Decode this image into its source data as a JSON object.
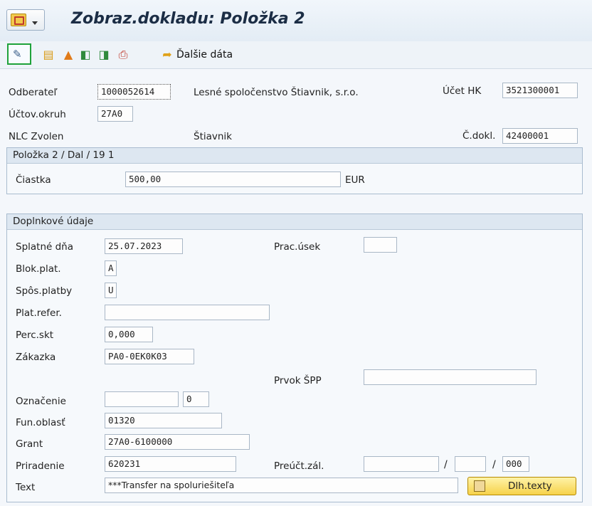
{
  "window": {
    "title": "Zobraz.dokladu: Položka 2"
  },
  "toolbar": {
    "icons": [
      "display-change-icon",
      "header-icon",
      "overview-icon",
      "previous-icon",
      "next-icon",
      "print-icon",
      "additional-data-icon"
    ],
    "more_label": "Ďalšie dáta"
  },
  "header": {
    "customer_label": "Odberateľ",
    "customer_value": "1000052614",
    "customer_name": "Lesné spoločenstvo Štiavnik, s.r.o.",
    "gl_label": "Účet HK",
    "gl_value": "3521300001",
    "company_code_label": "Účtov.okruh",
    "company_code_value": "27A0",
    "city_left": "NLC Zvolen",
    "city_right": "Štiavnik",
    "doc_label": "Č.dokl.",
    "doc_value": "42400001"
  },
  "item_group": {
    "title": "Položka 2 / Dal / 19 1",
    "amount_label": "Čiastka",
    "amount_value": "500,00",
    "currency": "EUR"
  },
  "additional": {
    "title": "Doplnkové údaje",
    "due_label": "Splatné dňa",
    "due_value": "25.07.2023",
    "bus_area_label": "Prac.úsek",
    "bus_area_value": "",
    "pay_block_label": "Blok.plat.",
    "pay_block_value": "A",
    "pay_method_label": "Spôs.platby",
    "pay_method_value": "U",
    "pay_ref_label": "Plat.refer.",
    "pay_ref_value": "",
    "disc_label": "Perc.skt",
    "disc_value": "0,000",
    "order_label": "Zákazka",
    "order_value": "PA0-0EK0K03",
    "wbs_label": "Prvok ŠPP",
    "wbs_value": "",
    "mark_label": "Označenie",
    "mark_value": "",
    "mark_value2": "0",
    "func_label": "Fun.oblasť",
    "func_value": "01320",
    "grant_label": "Grant",
    "grant_value": "27A0-6100000",
    "assign_label": "Priradenie",
    "assign_value": "620231",
    "recon_label": "Preúčt.zál.",
    "recon_value1": "",
    "recon_value2": "",
    "recon_value3": "000",
    "slash": "/",
    "text_label": "Text",
    "text_value": "***Transfer na spoluriešiteľa",
    "long_texts_button": "Dlh.texty"
  }
}
